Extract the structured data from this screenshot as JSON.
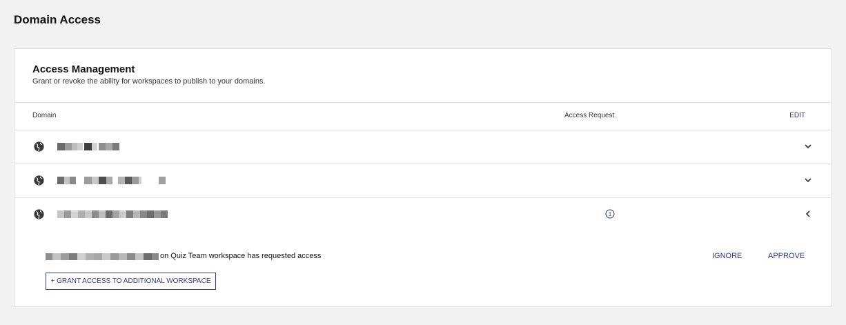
{
  "page": {
    "title": "Domain Access"
  },
  "card": {
    "title": "Access Management",
    "subtitle": "Grant or revoke the ability for workspaces to publish to your domains."
  },
  "table": {
    "col_domain": "Domain",
    "col_access_request": "Access Request",
    "edit_label": "EDIT"
  },
  "rows": [
    {
      "domain": "",
      "icon": "globe-icon",
      "pending_requests": null,
      "expanded": false
    },
    {
      "domain": "",
      "icon": "globe-icon",
      "pending_requests": null,
      "expanded": false
    },
    {
      "domain": "",
      "icon": "globe-icon",
      "pending_requests": "1",
      "expanded": true
    }
  ],
  "request": {
    "text": "on Quiz Team workspace has requested access",
    "ignore_label": "IGNORE",
    "approve_label": "APPROVE"
  },
  "grant_label": "+ GRANT ACCESS TO ADDITIONAL WORKSPACE",
  "colors": {
    "accent": "#2b3a8a",
    "background": "#f2f2f2",
    "border": "#e2e2e2"
  }
}
